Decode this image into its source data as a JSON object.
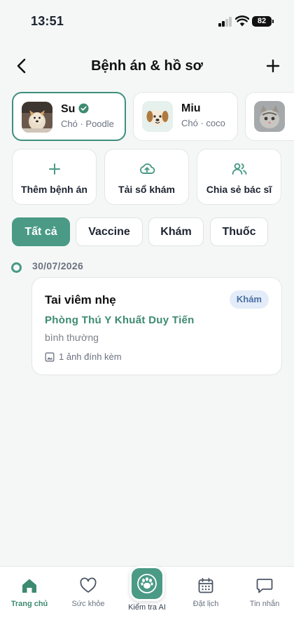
{
  "status_bar": {
    "time": "13:51",
    "battery": "82"
  },
  "header": {
    "title": "Bệnh án & hồ sơ",
    "back_icon": "chevron-left-icon",
    "add_icon": "plus-icon"
  },
  "pets": [
    {
      "name": "Su",
      "subtitle": "Chó · Poodle",
      "verified": true,
      "avatar": "dog-photo"
    },
    {
      "name": "Miu",
      "subtitle": "Chó · coco",
      "verified": false,
      "avatar": "dog-emoji"
    },
    {
      "name": "",
      "subtitle": "",
      "verified": false,
      "avatar": "cat-photo"
    }
  ],
  "actions": [
    {
      "label": "Thêm bệnh án",
      "icon": "plus-icon"
    },
    {
      "label": "Tải sổ khám",
      "icon": "cloud-upload-icon"
    },
    {
      "label": "Chia sẻ bác sĩ",
      "icon": "users-icon"
    }
  ],
  "filters": [
    {
      "label": "Tất cả",
      "active": true
    },
    {
      "label": "Vaccine",
      "active": false
    },
    {
      "label": "Khám",
      "active": false
    },
    {
      "label": "Thuốc",
      "active": false
    }
  ],
  "timeline": [
    {
      "date": "30/07/2026",
      "title": "Tai viêm nhẹ",
      "badge": "Khám",
      "clinic": "Phòng Thú Y Khuất Duy Tiến",
      "note": "bình thường",
      "attachment": "1 ảnh đính kèm"
    }
  ],
  "bottom_nav": [
    {
      "label": "Trang chủ",
      "icon": "home-icon",
      "active": true
    },
    {
      "label": "Sức khỏe",
      "icon": "heart-icon",
      "active": false
    },
    {
      "label": "Kiểm tra AI",
      "icon": "paw-icon",
      "active": false
    },
    {
      "label": "Đặt lịch",
      "icon": "calendar-icon",
      "active": false
    },
    {
      "label": "Tin nhắn",
      "icon": "chat-icon",
      "active": false
    }
  ],
  "colors": {
    "accent": "#4a9a86",
    "clinic_text": "#3d8a70",
    "badge_bg": "#e3ecf8",
    "badge_text": "#4a6fa5"
  }
}
